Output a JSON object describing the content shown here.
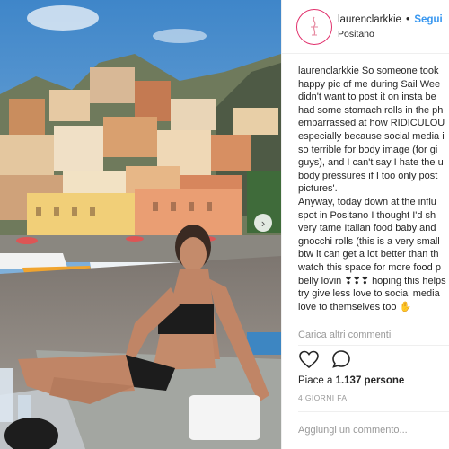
{
  "post": {
    "username": "laurenclarkkie",
    "separator": "•",
    "follow_label": "Segui",
    "location": "Positano"
  },
  "caption": {
    "username": "laurenclarkkie",
    "lines": [
      " So someone took",
      "happy pic of me during Sail Wee",
      "didn't want to post it on insta be",
      "had some stomach rolls in the ph",
      "embarrassed at how RIDICULOU",
      "especially because social media i",
      "so terrible for body image (for gi",
      "guys), and I can't say I hate the u",
      "body pressures if I too only post",
      "pictures'.",
      "Anyway, today down at the influ",
      "spot in Positano I thought I'd sh",
      "very tame Italian food baby and",
      "gnocchi rolls (this is a very small",
      "btw it can get a lot better than th",
      "watch this space for more food p",
      "belly lovin ❣❣❣ hoping this helps",
      "try give less love to social media",
      "love to themselves too ✋"
    ]
  },
  "more_comments": "Carica altri commenti",
  "actions": {
    "like_icon": "heart-icon",
    "comment_icon": "comment-icon"
  },
  "likes": {
    "prefix": "Piace a ",
    "count": "1.137",
    "suffix": " persone"
  },
  "date": "4 GIORNI FA",
  "comment_placeholder": "Aggiungi un commento...",
  "colors": {
    "link_blue": "#3897f0",
    "avatar_ring": "#e1306c",
    "muted": "#999999"
  }
}
